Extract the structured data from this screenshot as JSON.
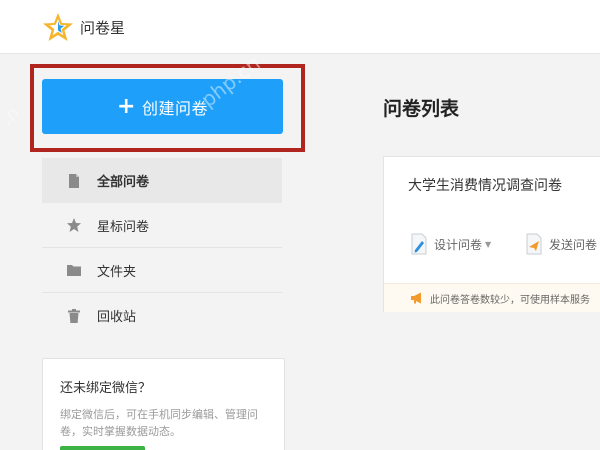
{
  "header": {
    "brand": "问卷星",
    "logo_icon": "star-logo-icon"
  },
  "sidebar": {
    "create_label": "创建问卷",
    "create_color": "#1ea0fa",
    "highlight_color": "#b0261f",
    "items": [
      {
        "label": "全部问卷",
        "icon": "document-icon",
        "active": true
      },
      {
        "label": "星标问卷",
        "icon": "star-icon",
        "active": false
      },
      {
        "label": "文件夹",
        "icon": "folder-icon",
        "active": false
      },
      {
        "label": "回收站",
        "icon": "trash-icon",
        "active": false
      }
    ],
    "wechat": {
      "title": "还未绑定微信？",
      "desc": "绑定微信后，可在手机同步编辑、管理问卷，实时掌握数据动态。"
    }
  },
  "main": {
    "title": "问卷列表",
    "survey": {
      "name": "大学生消费情况调查问卷",
      "design_label": "设计问卷",
      "send_label": "发送问卷",
      "notice": "此问卷答卷数较少，可使用样本服务"
    }
  },
  "watermark": "php.cn"
}
